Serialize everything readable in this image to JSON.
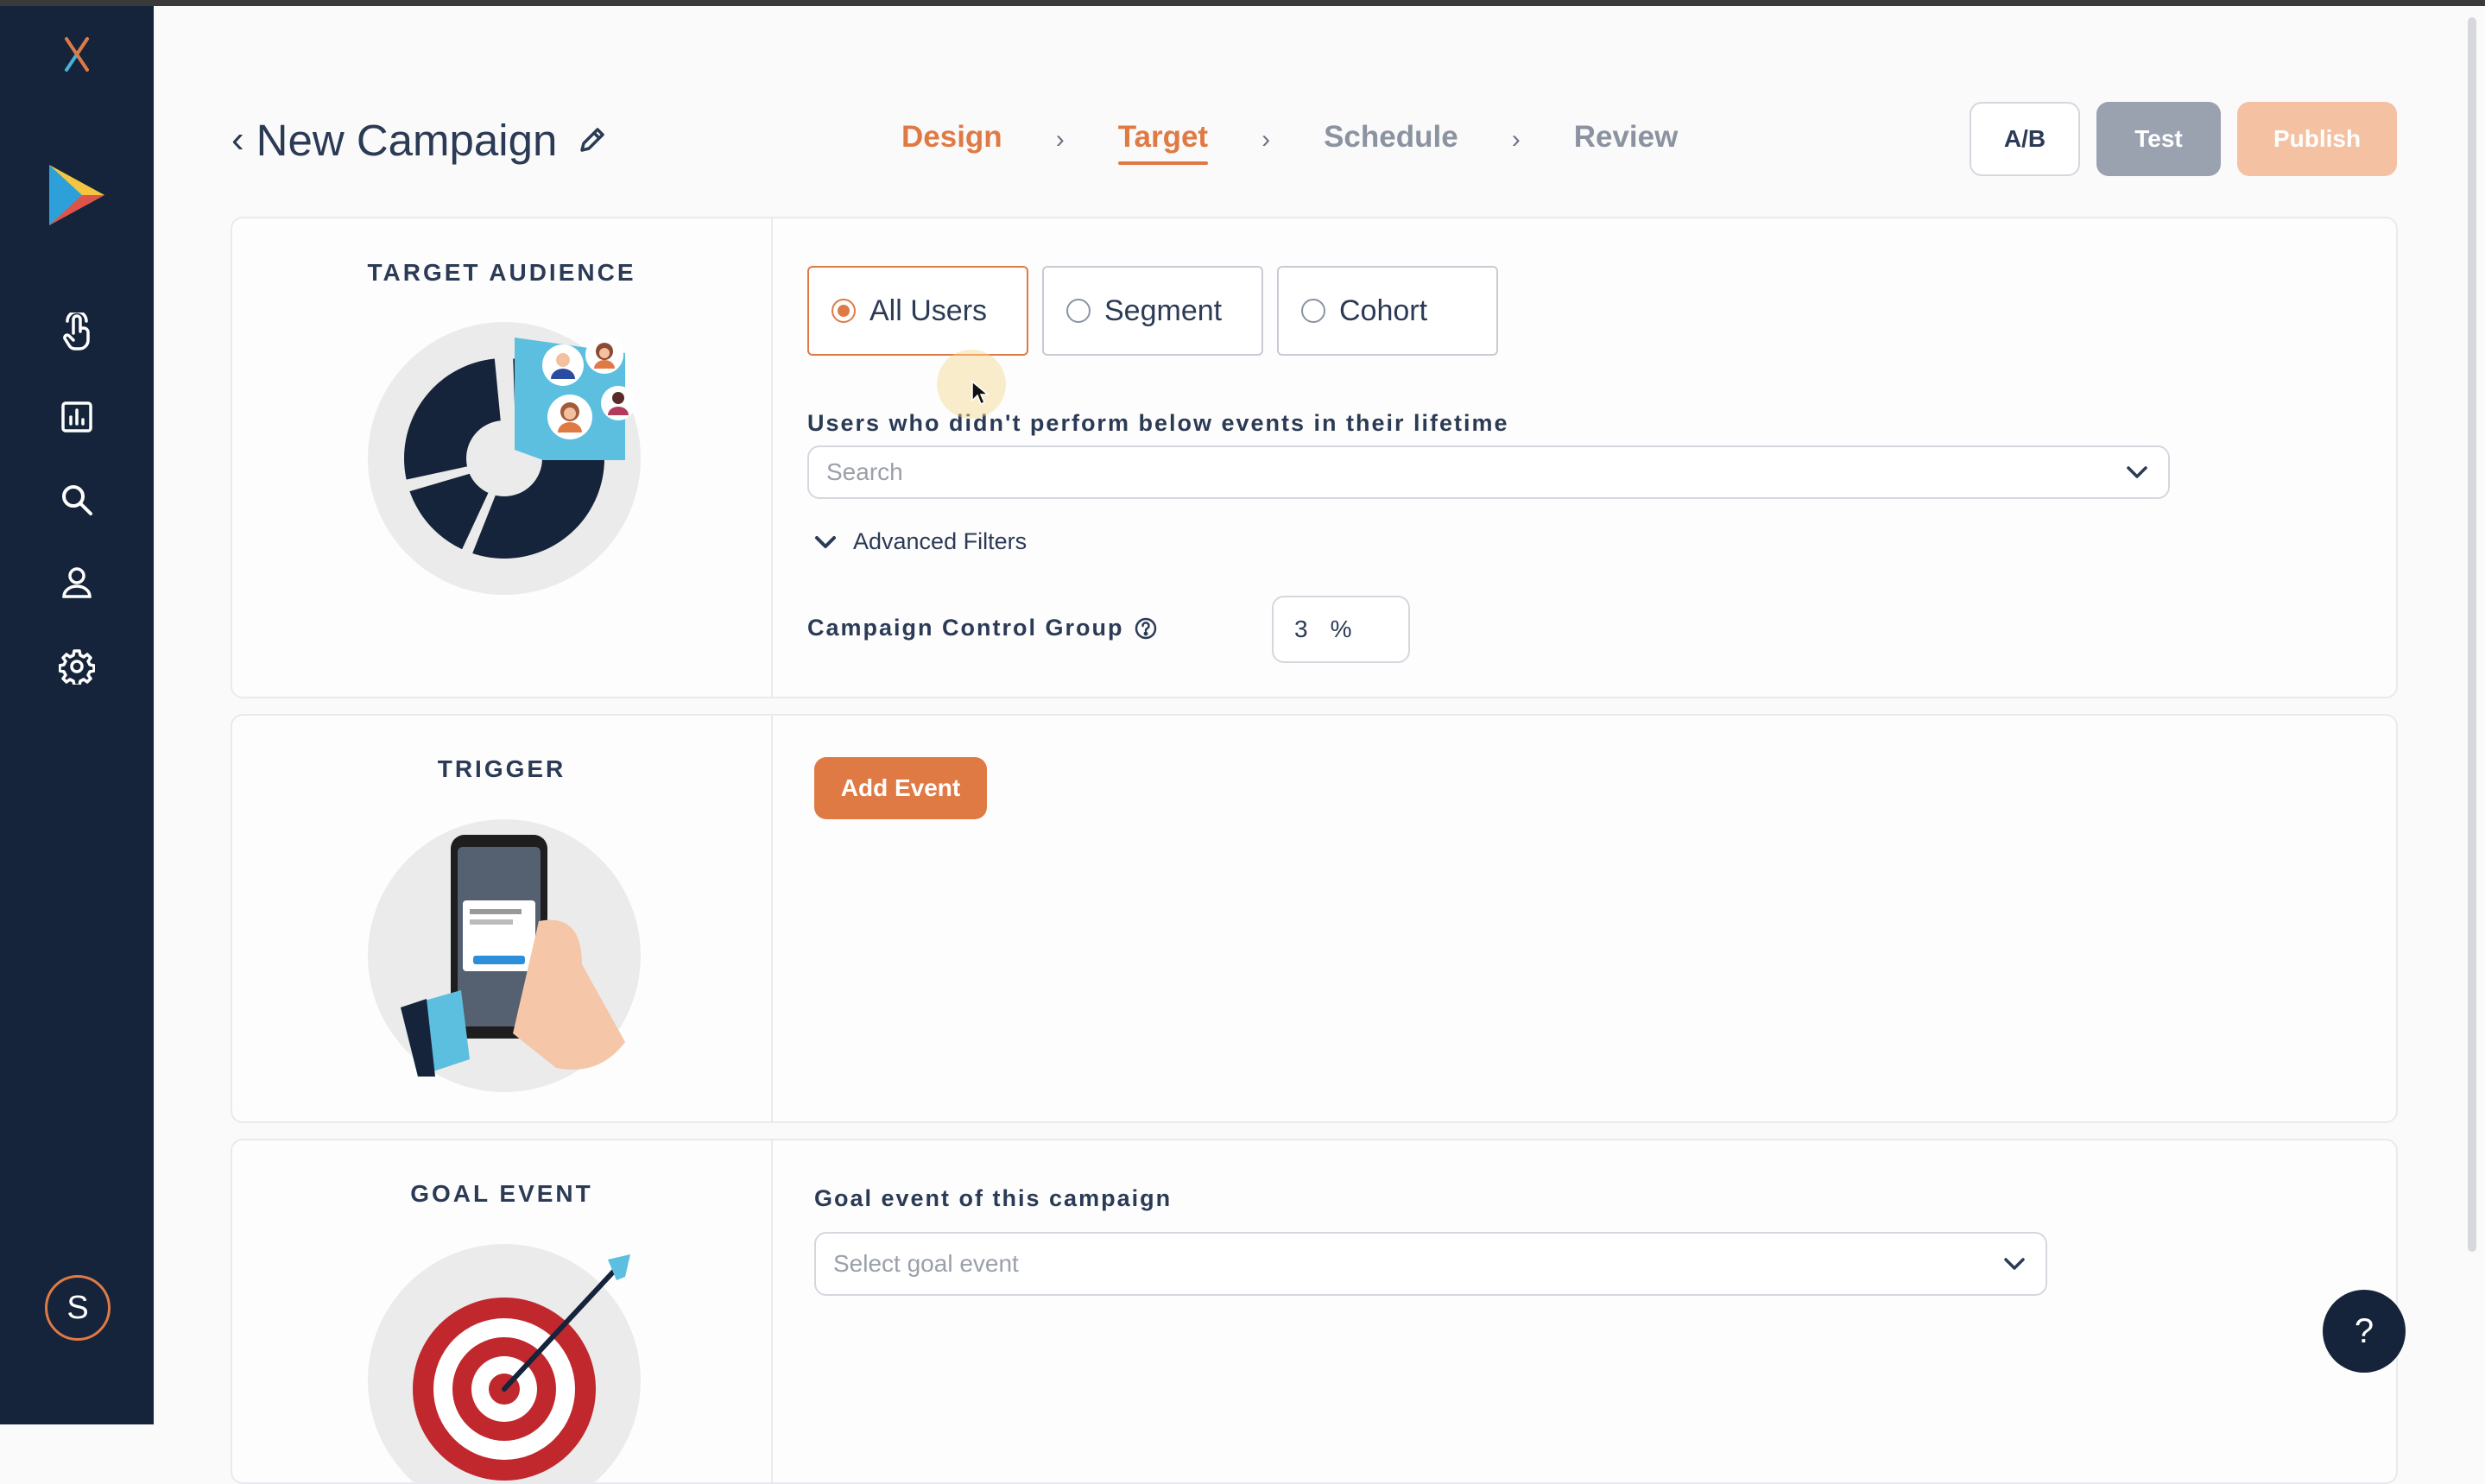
{
  "sidebar": {
    "icons": [
      "logo-x-icon",
      "play-logo-icon",
      "tap-icon",
      "analytics-icon",
      "search-icon",
      "user-icon",
      "settings-icon"
    ],
    "avatar_initial": "S"
  },
  "header": {
    "title": "New Campaign",
    "steps": [
      {
        "label": "Design",
        "state": "done"
      },
      {
        "label": "Target",
        "state": "active"
      },
      {
        "label": "Schedule",
        "state": "todo"
      },
      {
        "label": "Review",
        "state": "todo"
      }
    ],
    "buttons": {
      "ab": "A/B",
      "test": "Test",
      "publish": "Publish"
    }
  },
  "target_audience": {
    "title": "TARGET AUDIENCE",
    "options": [
      {
        "label": "All Users",
        "selected": true
      },
      {
        "label": "Segment",
        "selected": false
      },
      {
        "label": "Cohort",
        "selected": false
      }
    ],
    "events_label": "Users who didn't perform below events in their lifetime",
    "search_placeholder": "Search",
    "advanced_filters": "Advanced Filters",
    "control_group_label": "Campaign Control Group",
    "control_group_value": "3",
    "control_group_unit": "%"
  },
  "trigger": {
    "title": "TRIGGER",
    "add_event": "Add Event"
  },
  "goal_event": {
    "title": "GOAL EVENT",
    "label": "Goal event of this campaign",
    "placeholder": "Select goal event"
  },
  "help_label": "?",
  "colors": {
    "accent": "#e07a45",
    "sidebar": "#15243a",
    "muted_button": "#9aa2b0",
    "publish_disabled": "#f4c2a2"
  }
}
